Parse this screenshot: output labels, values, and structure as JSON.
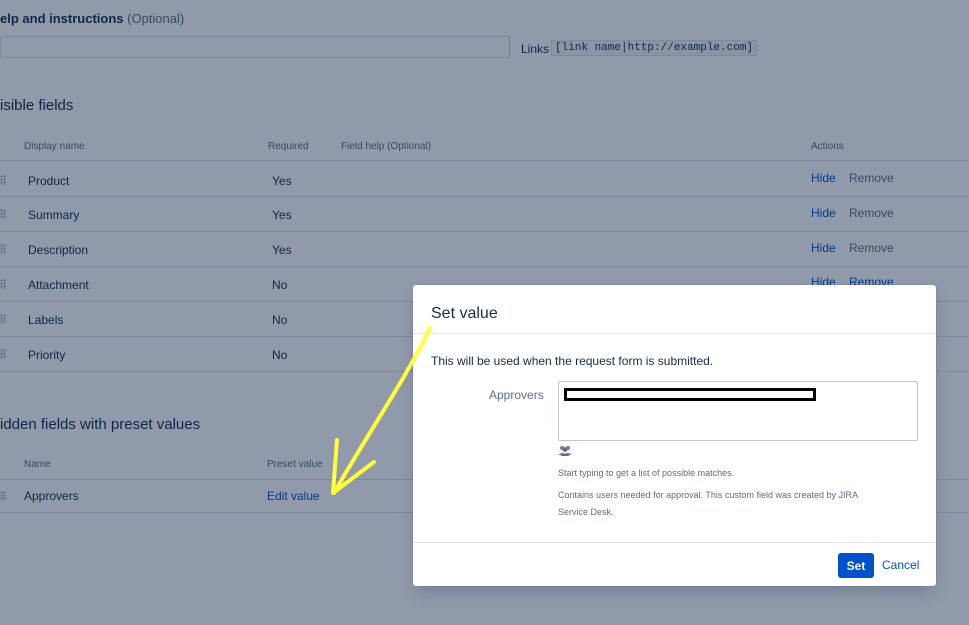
{
  "help": {
    "title": "elp and instructions",
    "optional": "(Optional)",
    "links_label": "Links",
    "links_code": "[link name|http://example.com]"
  },
  "visible_fields": {
    "title": "isible fields",
    "columns": [
      "Display name",
      "Required",
      "Field help (Optional)",
      "Actions"
    ],
    "rows": [
      {
        "name": "Product",
        "required": "Yes",
        "hide": "Hide",
        "remove": "Remove"
      },
      {
        "name": "Summary",
        "required": "Yes",
        "hide": "Hide",
        "remove": "Remove"
      },
      {
        "name": "Description",
        "required": "Yes",
        "hide": "Hide",
        "remove": "Remove"
      },
      {
        "name": "Attachment",
        "required": "No",
        "hide": "Hide",
        "remove": "Remove"
      },
      {
        "name": "Labels",
        "required": "No",
        "hide": "",
        "remove": ""
      },
      {
        "name": "Priority",
        "required": "No",
        "hide": "",
        "remove": ""
      }
    ]
  },
  "hidden_fields": {
    "title": "idden fields with preset values",
    "columns": [
      "Name",
      "Preset value"
    ],
    "rows": [
      {
        "name": "Approvers",
        "value": "Edit value"
      }
    ]
  },
  "dialog": {
    "title": "Set value",
    "description": "This will be used when the request form is submitted.",
    "field_label": "Approvers",
    "hint1": "Start typing to get a list of possible matches.",
    "hint2_line1": "Contains users needed for approval. This custom field was created by JIRA",
    "hint2_line2": "Service Desk.",
    "set_label": "Set",
    "cancel_label": "Cancel"
  },
  "icons": {
    "drag_handle": "drag-handle-icon",
    "users": "users-icon"
  },
  "colors": {
    "link": "#0052cc",
    "primary_button": "#0052cc",
    "annotation_arrow": "#ffff3a"
  }
}
